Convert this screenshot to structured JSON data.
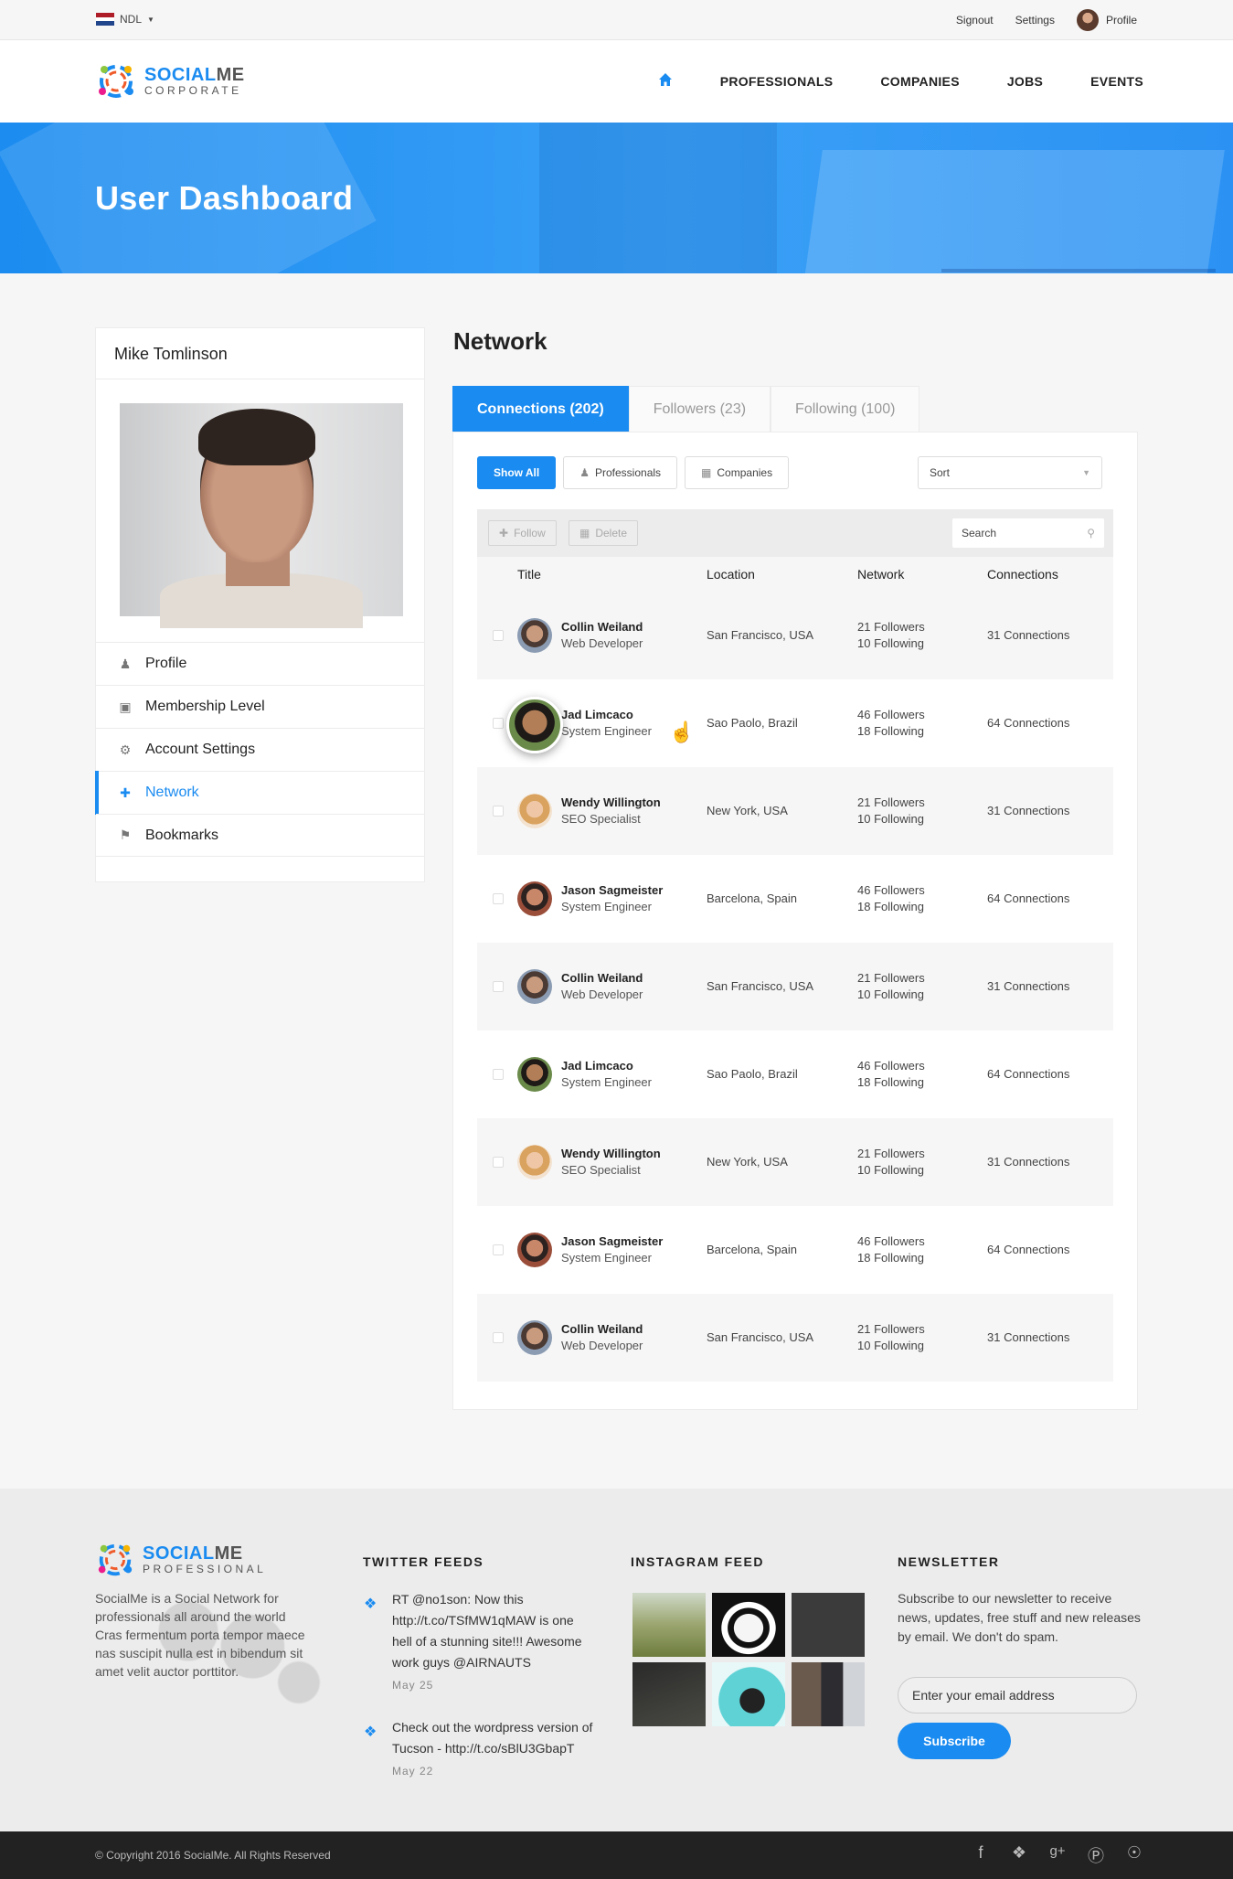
{
  "topbar": {
    "language": "NDL",
    "signout": "Signout",
    "settings": "Settings",
    "profile": "Profile"
  },
  "brand": {
    "name_a": "SOCIAL",
    "name_b": "ME",
    "tagline": "CORPORATE",
    "accent": "#1a8bf0"
  },
  "nav": {
    "items": [
      "PROFESSIONALS",
      "COMPANIES",
      "JOBS",
      "EVENTS"
    ],
    "home_icon": "home-icon"
  },
  "hero": {
    "title": "User Dashboard"
  },
  "sidebar": {
    "user_name": "Mike Tomlinson",
    "menu": [
      {
        "label": "Profile",
        "icon": "user-icon"
      },
      {
        "label": "Membership Level",
        "icon": "membership-icon"
      },
      {
        "label": "Account Settings",
        "icon": "gear-icon"
      },
      {
        "label": "Network",
        "icon": "add-user-icon"
      },
      {
        "label": "Bookmarks",
        "icon": "bookmark-icon"
      }
    ]
  },
  "network": {
    "title": "Network",
    "tabs": [
      "Connections (202)",
      "Followers (23)",
      "Following (100)"
    ],
    "filters": [
      "Show All",
      "Professionals",
      "Companies"
    ],
    "sort_label": "Sort",
    "toolbar": {
      "follow": "Follow",
      "delete": "Delete",
      "search_placeholder": "Search"
    },
    "columns": [
      "Title",
      "Location",
      "Network",
      "Connections"
    ],
    "rows": [
      {
        "name": "Collin Weiland",
        "role": "Web Developer",
        "location": "San Francisco, USA",
        "followers": "21 Followers",
        "following": "10 Following",
        "connections": "31 Connections"
      },
      {
        "name": "Jad Limcaco",
        "role": "System Engineer",
        "location": "Sao Paolo, Brazil",
        "followers": "46 Followers",
        "following": "18 Following",
        "connections": "64 Connections"
      },
      {
        "name": "Wendy Willington",
        "role": "SEO Specialist",
        "location": "New York, USA",
        "followers": "21 Followers",
        "following": "10 Following",
        "connections": "31 Connections"
      },
      {
        "name": "Jason Sagmeister",
        "role": "System Engineer",
        "location": "Barcelona, Spain",
        "followers": "46 Followers",
        "following": "18 Following",
        "connections": "64 Connections"
      },
      {
        "name": "Collin Weiland",
        "role": "Web Developer",
        "location": "San Francisco, USA",
        "followers": "21 Followers",
        "following": "10 Following",
        "connections": "31 Connections"
      },
      {
        "name": "Jad Limcaco",
        "role": "System Engineer",
        "location": "Sao Paolo, Brazil",
        "followers": "46 Followers",
        "following": "18 Following",
        "connections": "64 Connections"
      },
      {
        "name": "Wendy Willington",
        "role": "SEO Specialist",
        "location": "New York, USA",
        "followers": "21 Followers",
        "following": "10 Following",
        "connections": "31 Connections"
      },
      {
        "name": "Jason Sagmeister",
        "role": "System Engineer",
        "location": "Barcelona, Spain",
        "followers": "46 Followers",
        "following": "18 Following",
        "connections": "64 Connections"
      },
      {
        "name": "Collin Weiland",
        "role": "Web Developer",
        "location": "San Francisco, USA",
        "followers": "21 Followers",
        "following": "10 Following",
        "connections": "31 Connections"
      }
    ]
  },
  "footer": {
    "logo_tagline": "PROFESSIONAL",
    "about": "SocialMe is a Social Network for professionals all around the world Cras fermentum porta tempor maece nas suscipit nulla est in bibendum sit amet velit auctor porttitor.",
    "twitter_title": "TWITTER FEEDS",
    "tweets": [
      {
        "text": "RT @no1son: Now this http://t.co/TSfMW1qMAW is one hell of a stunning site!!! Awesome work guys @AIRNAUTS",
        "date": "May 25"
      },
      {
        "text": "Check out the wordpress version of Tucson - http://t.co/sBlU3GbapT",
        "date": "May 22"
      }
    ],
    "instagram_title": "INSTAGRAM FEED",
    "newsletter_title": "NEWSLETTER",
    "newsletter_text": "Subscribe to our newsletter to receive news, updates, free stuff and new releases by email. We don't do spam.",
    "email_placeholder": "Enter your email address",
    "subscribe": "Subscribe",
    "copyright": "© Copyright 2016 SocialMe. All Rights Reserved"
  }
}
